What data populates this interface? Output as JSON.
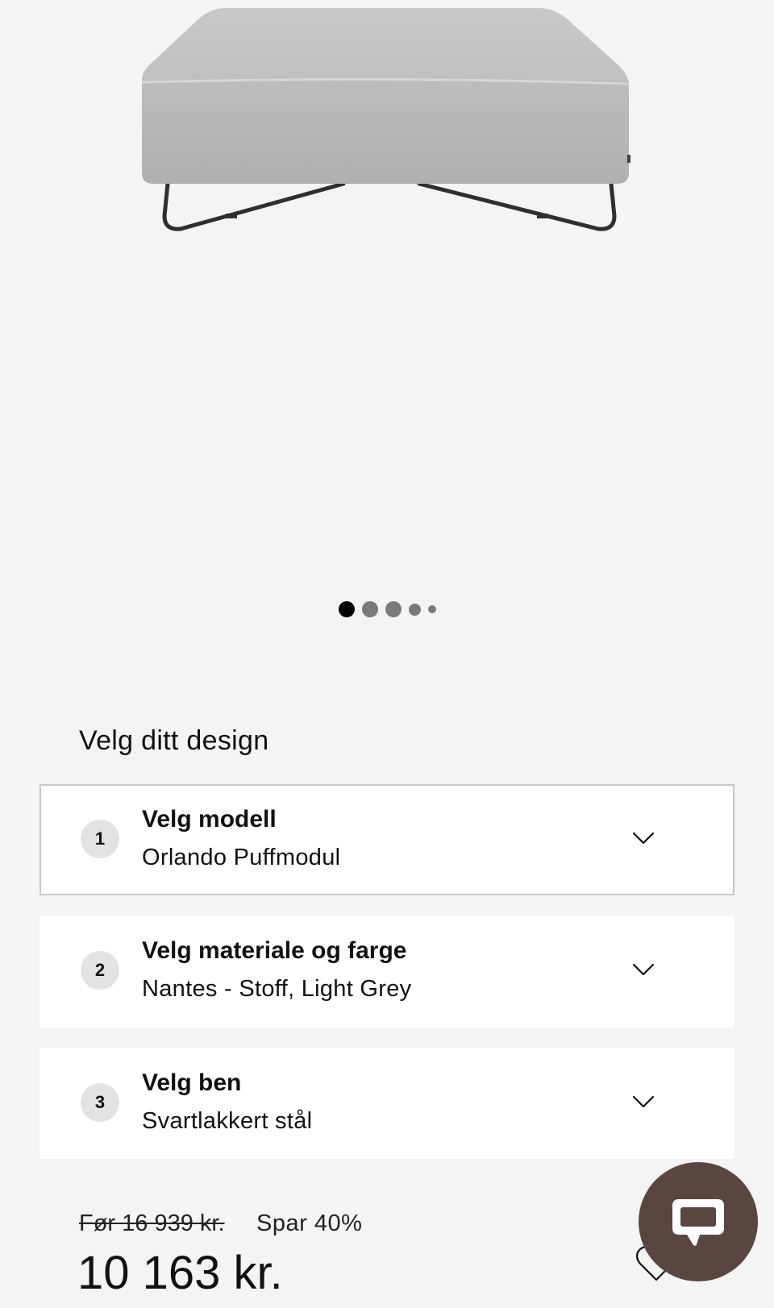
{
  "product": {
    "image_alt": "Orlando Puffmodul ottoman"
  },
  "carousel": {
    "slide_count": 5,
    "active_index": 0
  },
  "configurator": {
    "title": "Velg ditt design",
    "steps": [
      {
        "number": "1",
        "title": "Velg modell",
        "value": "Orlando Puffmodul",
        "active": true
      },
      {
        "number": "2",
        "title": "Velg materiale og farge",
        "value": "Nantes - Stoff, Light Grey",
        "active": false
      },
      {
        "number": "3",
        "title": "Velg ben",
        "value": "Svartlakkert stål",
        "active": false
      }
    ]
  },
  "pricing": {
    "old_price": "Før 16 939 kr.",
    "savings": "Spar 40%",
    "current_price": "10 163 kr."
  },
  "icons": {
    "chevron": "chevron-down-icon",
    "wishlist": "heart-icon",
    "chat": "chat-bubble-icon"
  },
  "colors": {
    "background": "#f4f4f4",
    "card": "#ffffff",
    "active_border": "#c8c8c8",
    "step_badge": "#e3e3e3",
    "chat_button": "#5a4641",
    "dot_active": "#000000",
    "dot_inactive": "#7a7a7a"
  }
}
